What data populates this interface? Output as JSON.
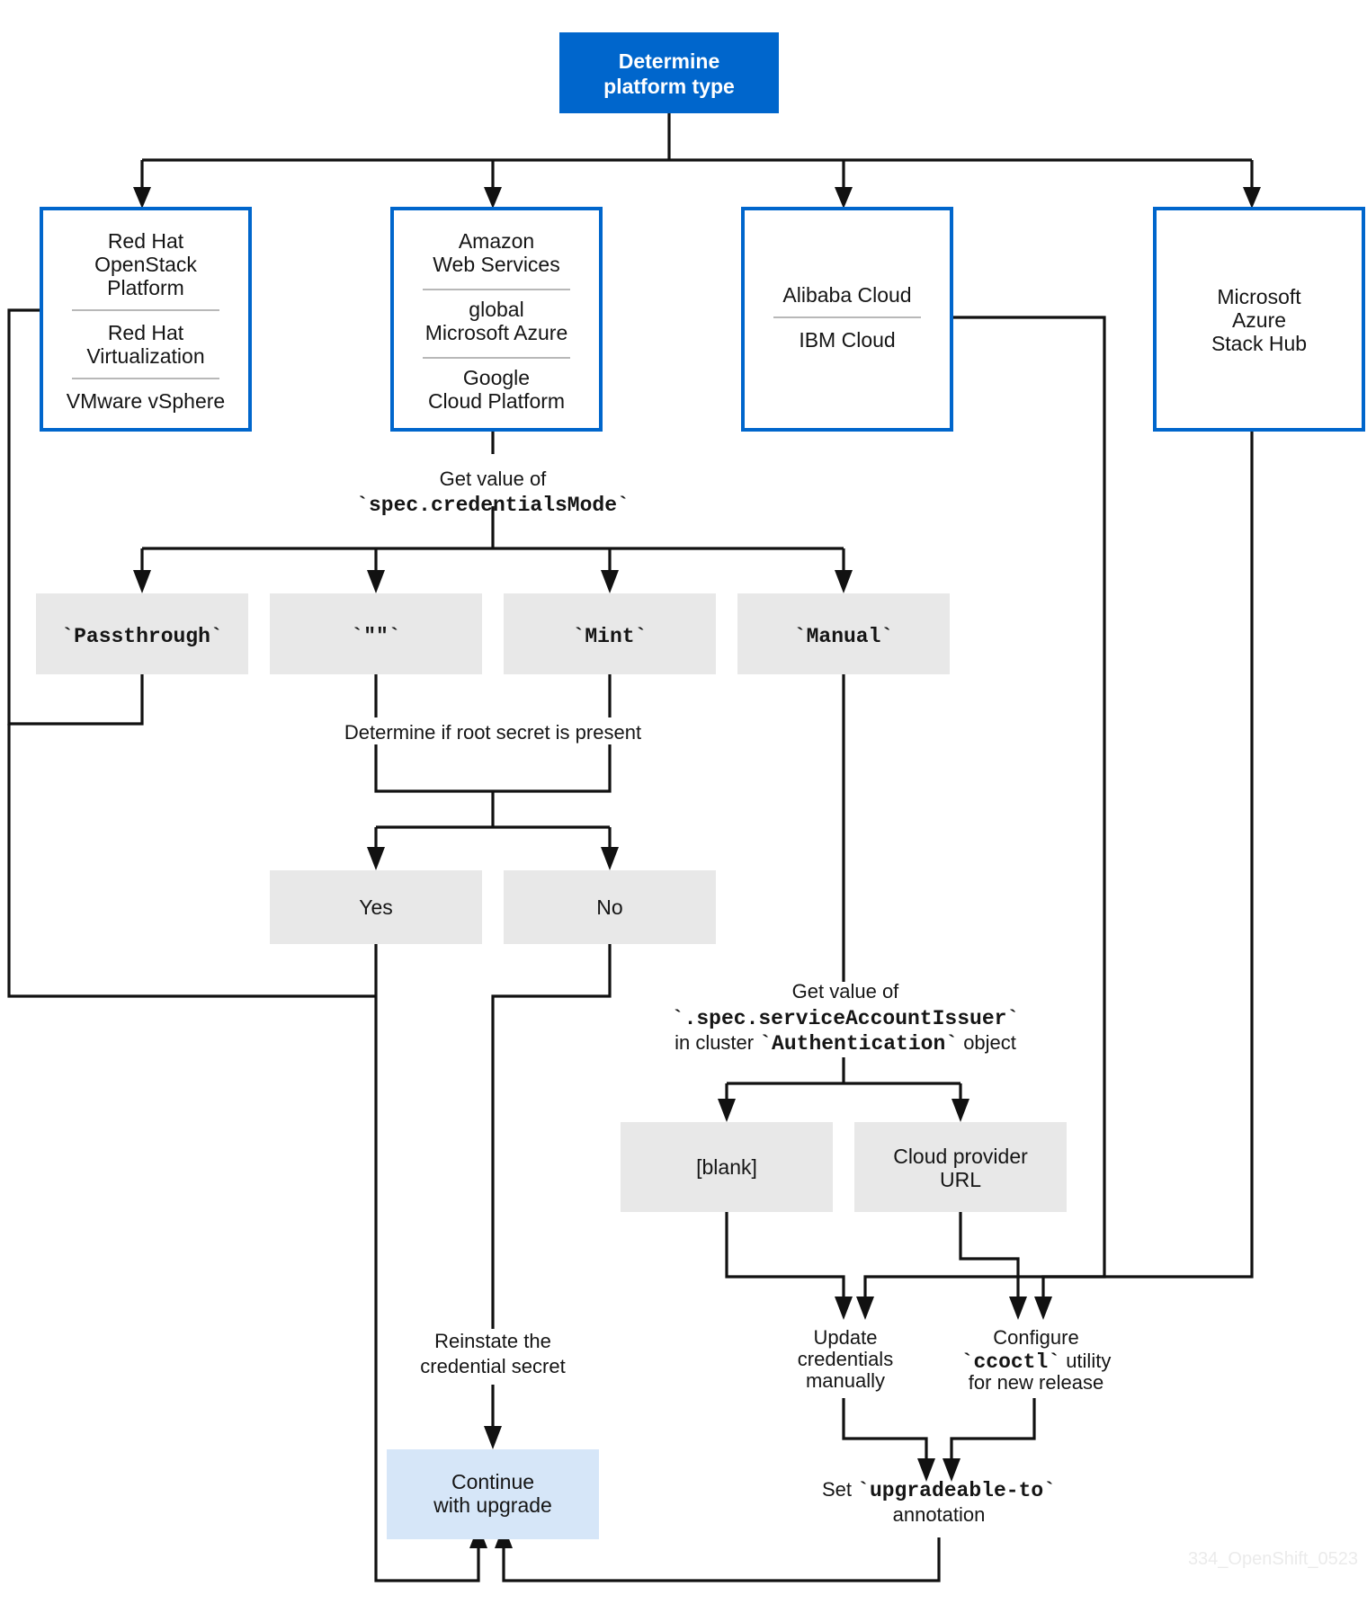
{
  "diagram": {
    "title": "Determine platform type",
    "watermark": "334_OpenShift_0523",
    "colors": {
      "accent": "#0066cc",
      "start_fill": "#0066cc",
      "gray_fill": "#e8e8e8",
      "final_fill": "#d6e6f8",
      "line": "#111111",
      "divider": "#b8b8b8"
    },
    "start_node": {
      "line1": "Determine",
      "line2": "platform type"
    },
    "platform_groups": [
      {
        "id": "group-openstack",
        "entries": [
          {
            "lines": [
              "Red Hat",
              "OpenStack",
              "Platform"
            ]
          },
          {
            "lines": [
              "Red Hat",
              "Virtualization"
            ]
          },
          {
            "lines": [
              "VMware vSphere"
            ]
          }
        ]
      },
      {
        "id": "group-aws",
        "entries": [
          {
            "lines": [
              "Amazon",
              "Web Services"
            ]
          },
          {
            "lines": [
              "global",
              "Microsoft Azure"
            ]
          },
          {
            "lines": [
              "Google",
              "Cloud Platform"
            ]
          }
        ]
      },
      {
        "id": "group-alibaba",
        "entries": [
          {
            "lines": [
              "Alibaba Cloud"
            ]
          },
          {
            "lines": [
              "IBM Cloud"
            ]
          }
        ]
      },
      {
        "id": "group-azure-stack-hub",
        "entries": [
          {
            "lines": [
              "Microsoft",
              "Azure",
              "Stack Hub"
            ]
          }
        ]
      }
    ],
    "labels": {
      "get_credentials_mode": {
        "line1": "Get value of",
        "line2": "`spec.credentialsMode`"
      },
      "determine_root_secret": "Determine if root secret is present",
      "get_service_account_issuer": {
        "line1": "Get value of",
        "line2": "`.spec.serviceAccountIssuer`",
        "line3_prefix": "in cluster ",
        "line3_code": "`Authentication`",
        "line3_suffix": " object"
      },
      "reinstate_secret": {
        "line1": "Reinstate the",
        "line2": "credential secret"
      },
      "update_credentials": {
        "line1": "Update",
        "line2": "credentials",
        "line3": "manually"
      },
      "configure_ccoctl": {
        "line1": "Configure",
        "line2_code": "`ccoctl`",
        "line2_suffix": " utility",
        "line3": "for new release"
      },
      "set_upgradeable": {
        "line1_prefix": "Set ",
        "line1_code": "`upgradeable-to`",
        "line2": "annotation"
      }
    },
    "credentials_modes": [
      {
        "id": "mode-passthrough",
        "label": "`Passthrough`"
      },
      {
        "id": "mode-empty",
        "label": "`\"\"`"
      },
      {
        "id": "mode-mint",
        "label": "`Mint`"
      },
      {
        "id": "mode-manual",
        "label": "`Manual`"
      }
    ],
    "root_secret_answers": [
      {
        "id": "answer-yes",
        "label": "Yes"
      },
      {
        "id": "answer-no",
        "label": "No"
      }
    ],
    "issuer_values": [
      {
        "id": "issuer-blank",
        "lines": [
          "[blank]"
        ]
      },
      {
        "id": "issuer-cloud-url",
        "lines": [
          "Cloud provider",
          "URL"
        ]
      }
    ],
    "final_node": {
      "line1": "Continue",
      "line2": "with upgrade"
    }
  }
}
